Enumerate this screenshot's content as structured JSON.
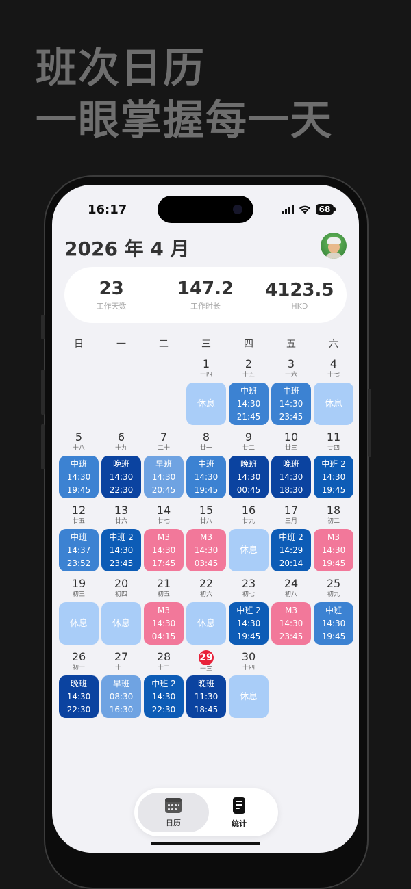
{
  "promo": {
    "line1": "班次日历",
    "line2": "一眼掌握每一天"
  },
  "status_bar": {
    "time": "16:17",
    "battery": "68"
  },
  "header": {
    "title": "2026 年 4 月"
  },
  "stats": [
    {
      "value": "23",
      "label": "工作天数"
    },
    {
      "value": "147.2",
      "label": "工作时长"
    },
    {
      "value": "4123.5",
      "label": "HKD"
    }
  ],
  "weekdays": [
    "日",
    "一",
    "二",
    "三",
    "四",
    "五",
    "六"
  ],
  "colors": {
    "rest": "#a9cdf8",
    "mid": "#3c82d2",
    "late": "#0b43a0",
    "early": "#6fa3e2",
    "mid2": "#0d5cb6",
    "m3": "#f2789a",
    "today": "#e8223a"
  },
  "days": [
    {
      "d": "",
      "l": ""
    },
    {
      "d": "",
      "l": ""
    },
    {
      "d": "",
      "l": ""
    },
    {
      "d": "1",
      "l": "十四",
      "s": "休息",
      "t": "rest"
    },
    {
      "d": "2",
      "l": "十五",
      "s": "中班",
      "a": "14:30",
      "b": "21:45",
      "t": "mid"
    },
    {
      "d": "3",
      "l": "十六",
      "s": "中班",
      "a": "14:30",
      "b": "23:45",
      "t": "mid"
    },
    {
      "d": "4",
      "l": "十七",
      "s": "休息",
      "t": "rest"
    },
    {
      "d": "5",
      "l": "十八",
      "s": "中班",
      "a": "14:30",
      "b": "19:45",
      "t": "mid"
    },
    {
      "d": "6",
      "l": "十九",
      "s": "晚班",
      "a": "14:30",
      "b": "22:30",
      "t": "late"
    },
    {
      "d": "7",
      "l": "二十",
      "s": "早班",
      "a": "14:30",
      "b": "20:45",
      "t": "early"
    },
    {
      "d": "8",
      "l": "廿一",
      "s": "中班",
      "a": "14:30",
      "b": "19:45",
      "t": "mid"
    },
    {
      "d": "9",
      "l": "廿二",
      "s": "晚班",
      "a": "14:30",
      "b": "00:45",
      "t": "late"
    },
    {
      "d": "10",
      "l": "廿三",
      "s": "晚班",
      "a": "14:30",
      "b": "18:30",
      "t": "late"
    },
    {
      "d": "11",
      "l": "廿四",
      "s": "中班 2",
      "a": "14:30",
      "b": "19:45",
      "t": "mid2"
    },
    {
      "d": "12",
      "l": "廿五",
      "s": "中班",
      "a": "14:37",
      "b": "23:52",
      "t": "mid"
    },
    {
      "d": "13",
      "l": "廿六",
      "s": "中班 2",
      "a": "14:30",
      "b": "23:45",
      "t": "mid2"
    },
    {
      "d": "14",
      "l": "廿七",
      "s": "M3",
      "a": "14:30",
      "b": "17:45",
      "t": "m3"
    },
    {
      "d": "15",
      "l": "廿八",
      "s": "M3",
      "a": "14:30",
      "b": "03:45",
      "t": "m3"
    },
    {
      "d": "16",
      "l": "廿九",
      "s": "休息",
      "t": "rest"
    },
    {
      "d": "17",
      "l": "三月",
      "s": "中班 2",
      "a": "14:29",
      "b": "20:14",
      "t": "mid2"
    },
    {
      "d": "18",
      "l": "初二",
      "s": "M3",
      "a": "14:30",
      "b": "19:45",
      "t": "m3"
    },
    {
      "d": "19",
      "l": "初三",
      "s": "休息",
      "t": "rest"
    },
    {
      "d": "20",
      "l": "初四",
      "s": "休息",
      "t": "rest"
    },
    {
      "d": "21",
      "l": "初五",
      "s": "M3",
      "a": "14:30",
      "b": "04:15",
      "t": "m3"
    },
    {
      "d": "22",
      "l": "初六",
      "s": "休息",
      "t": "rest"
    },
    {
      "d": "23",
      "l": "初七",
      "s": "中班 2",
      "a": "14:30",
      "b": "19:45",
      "t": "mid2"
    },
    {
      "d": "24",
      "l": "初八",
      "s": "M3",
      "a": "14:30",
      "b": "23:45",
      "t": "m3"
    },
    {
      "d": "25",
      "l": "初九",
      "s": "中班",
      "a": "14:30",
      "b": "19:45",
      "t": "mid"
    },
    {
      "d": "26",
      "l": "初十",
      "s": "晚班",
      "a": "14:30",
      "b": "22:30",
      "t": "late"
    },
    {
      "d": "27",
      "l": "十一",
      "s": "早班",
      "a": "08:30",
      "b": "16:30",
      "t": "early"
    },
    {
      "d": "28",
      "l": "十二",
      "s": "中班 2",
      "a": "14:30",
      "b": "22:30",
      "t": "mid2"
    },
    {
      "d": "29",
      "l": "十三",
      "s": "晚班",
      "a": "11:30",
      "b": "18:45",
      "t": "late",
      "today": true
    },
    {
      "d": "30",
      "l": "十四",
      "s": "休息",
      "t": "rest"
    }
  ],
  "tabbar": {
    "calendar_label": "日历",
    "stats_label": "统计"
  },
  "icons": {
    "calendar": "calendar-icon",
    "stats": "document-icon",
    "signal": "signal-icon",
    "wifi": "wifi-icon",
    "battery": "battery-icon"
  }
}
